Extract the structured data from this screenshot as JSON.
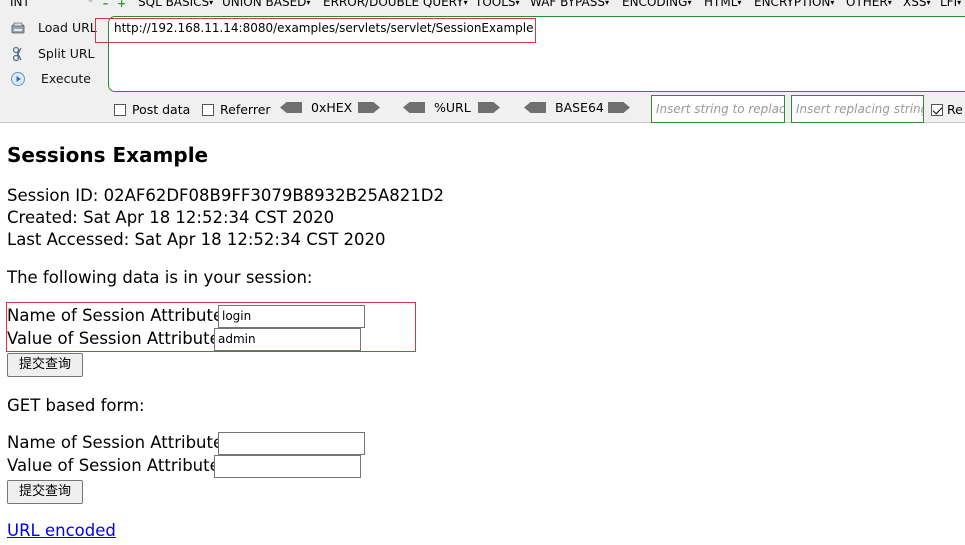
{
  "hackbar": {
    "int_select": "INT",
    "menu": [
      {
        "label": "SQL BASICS"
      },
      {
        "label": "UNION BASED"
      },
      {
        "label": "ERROR/DOUBLE QUERY"
      },
      {
        "label": "TOOLS"
      },
      {
        "label": "WAF BYPASS"
      },
      {
        "label": "ENCODING"
      },
      {
        "label": "HTML"
      },
      {
        "label": "ENCRYPTION"
      },
      {
        "label": "OTHER"
      },
      {
        "label": "XSS"
      },
      {
        "label": "LFI"
      }
    ],
    "actions": {
      "load_url": "Load URL",
      "split_url": "Split URL",
      "execute": "Execute"
    },
    "url": "http://192.168.11.14:8080/examples/servlets/servlet/SessionExample",
    "options": {
      "post_data": "Post data",
      "referrer": "Referrer",
      "hex": "0xHEX",
      "url_enc": "%URL",
      "base64": "BASE64",
      "replace_placeholder": "Insert string to replace",
      "replacing_placeholder": "Insert replacing string",
      "replace_all_partial": "Re"
    },
    "colors": {
      "input_border": "#2e8b2e",
      "highlight": "#d9373f"
    }
  },
  "page": {
    "title": "Sessions Example",
    "session_id": "Session ID: 02AF62DF08B9FF3079B8932B25A821D2",
    "created": "Created: Sat Apr 18 12:52:34 CST 2020",
    "last_accessed": "Last Accessed: Sat Apr 18 12:52:34 CST 2020",
    "session_data_heading": "The following data is in your session:",
    "form1": {
      "name_label": "Name of Session Attribute:",
      "name_value": "login",
      "value_label": "Value of Session Attribute:",
      "value_value": "admin",
      "submit": "提交查询"
    },
    "get_form_heading": "GET based form:",
    "form2": {
      "name_label": "Name of Session Attribute:",
      "name_value": "",
      "value_label": "Value of Session Attribute:",
      "value_value": "",
      "submit": "提交查询"
    },
    "url_encoded_link": "URL encoded"
  }
}
